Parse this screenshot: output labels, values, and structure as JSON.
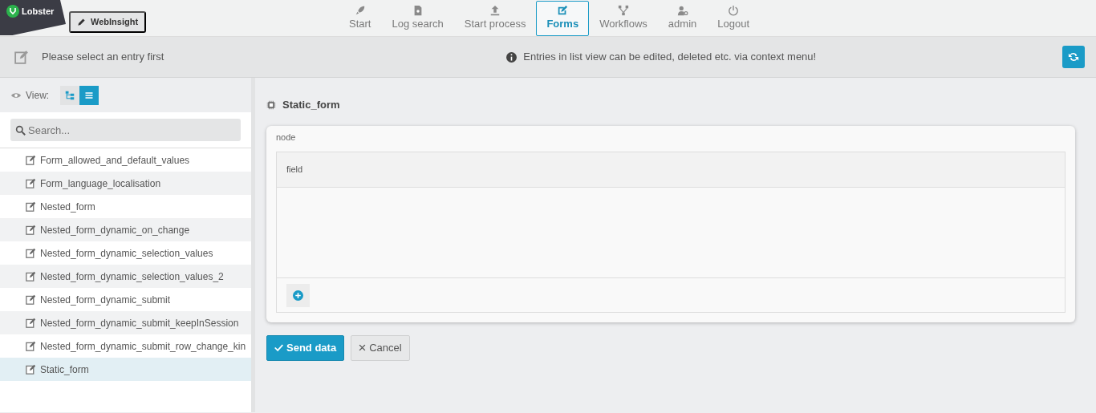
{
  "brand": {
    "logo": "Lobster",
    "app": "WebInsight"
  },
  "nav": [
    {
      "label": "Start",
      "kind": "start",
      "selected": false
    },
    {
      "label": "Log search",
      "kind": "logs",
      "selected": false
    },
    {
      "label": "Start process",
      "kind": "process",
      "selected": false
    },
    {
      "label": "Forms",
      "kind": "forms",
      "selected": true
    },
    {
      "label": "Workflows",
      "kind": "workflows",
      "selected": false
    },
    {
      "label": "admin",
      "kind": "account",
      "selected": false
    },
    {
      "label": "Logout",
      "kind": "logout",
      "selected": false
    }
  ],
  "subheader": {
    "message": "Please select an entry first",
    "info": "Entries in list view can be edited, deleted etc. via context menu!"
  },
  "sidebar": {
    "view_label": "View:",
    "views": [
      {
        "kind": "tree",
        "selected": false
      },
      {
        "kind": "list",
        "selected": true
      }
    ],
    "search": {
      "placeholder": "Search..."
    },
    "items": [
      {
        "label": "Form_allowed_and_default_values",
        "selected": false
      },
      {
        "label": "Form_language_localisation",
        "selected": false
      },
      {
        "label": "Nested_form",
        "selected": false
      },
      {
        "label": "Nested_form_dynamic_on_change",
        "selected": false
      },
      {
        "label": "Nested_form_dynamic_selection_values",
        "selected": false
      },
      {
        "label": "Nested_form_dynamic_selection_values_2",
        "selected": false
      },
      {
        "label": "Nested_form_dynamic_submit",
        "selected": false
      },
      {
        "label": "Nested_form_dynamic_submit_keepInSession",
        "selected": false
      },
      {
        "label": "Nested_form_dynamic_submit_row_change_kin",
        "selected": false
      },
      {
        "label": "Static_form",
        "selected": true
      }
    ]
  },
  "form": {
    "title": "Static_form",
    "node_label": "node",
    "field_label": "field",
    "buttons": [
      {
        "label": "Send data",
        "kind": "primary"
      },
      {
        "label": "Cancel",
        "kind": "secondary"
      }
    ]
  }
}
